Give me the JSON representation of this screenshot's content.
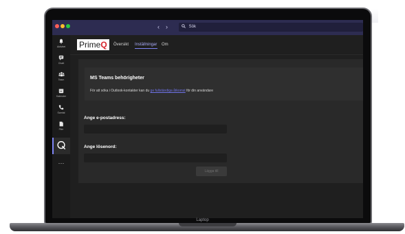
{
  "titlebar": {
    "back_glyph": "‹",
    "forward_glyph": "›",
    "search_placeholder": "Sök",
    "search_icon": "search-icon"
  },
  "rail": {
    "items": [
      {
        "label": "Aktivitet",
        "icon": "bell-icon",
        "glyph": "🔔"
      },
      {
        "label": "Chatt",
        "icon": "chat-icon",
        "glyph": "▤"
      },
      {
        "label": "Team",
        "icon": "team-icon",
        "glyph": "⁂"
      },
      {
        "label": "Kalender",
        "icon": "calendar-icon",
        "glyph": "▦"
      },
      {
        "label": "Samtal",
        "icon": "phone-icon",
        "glyph": "✆"
      },
      {
        "label": "Filer",
        "icon": "file-icon",
        "glyph": "▮"
      }
    ],
    "active_app": "PrimeQ",
    "more_glyph": "···"
  },
  "header": {
    "logo_text": "Prime",
    "logo_q": "Q",
    "tabs": [
      {
        "label": "Översikt"
      },
      {
        "label": "Inställningar",
        "active": true
      },
      {
        "label": "Om"
      }
    ]
  },
  "card": {
    "title": "MS Teams behörigheter",
    "text_before": "För att söka i Outlook-kontakter kan du ",
    "link": "ge fullständiga åtkomst",
    "text_after": " för din användare"
  },
  "form": {
    "email_label": "Ange e-postadress:",
    "email_value": "",
    "password_label": "Ange lösenord:",
    "password_value": "",
    "add_button": "Lägga till"
  },
  "laptop": {
    "label": "Laptop"
  },
  "colors": {
    "titlebar": "#2d2c51",
    "accent": "#7f85f5",
    "link": "#6f73e8",
    "brand_red": "#d6232b"
  }
}
